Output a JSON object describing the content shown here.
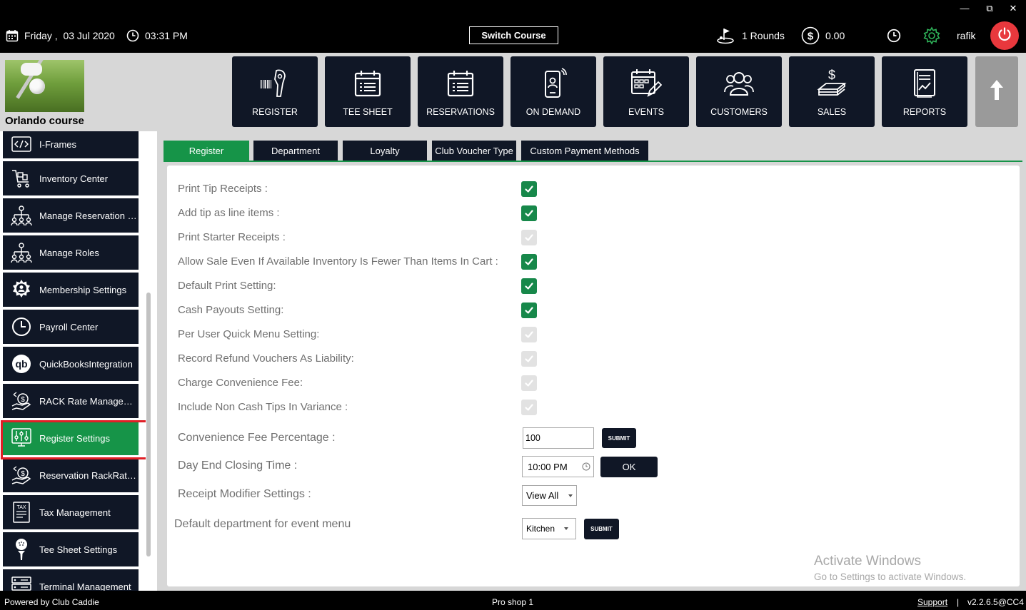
{
  "window_controls": {
    "minimize": "—",
    "restore": "⧉",
    "close": "✕"
  },
  "status_bar": {
    "date": "Friday ,  03 Jul 2020",
    "time": "03:31 PM",
    "switch_course": "Switch Course",
    "rounds": "1 Rounds",
    "balance": "0.00",
    "user": "rafik"
  },
  "course": {
    "name": "Orlando course"
  },
  "nav_tiles": [
    {
      "label": "REGISTER",
      "icon": "barcode-scanner-icon"
    },
    {
      "label": "TEE SHEET",
      "icon": "calendar-list-icon"
    },
    {
      "label": "RESERVATIONS",
      "icon": "calendar-list-icon"
    },
    {
      "label": "ON DEMAND",
      "icon": "mobile-person-icon"
    },
    {
      "label": "EVENTS",
      "icon": "calendar-edit-icon"
    },
    {
      "label": "CUSTOMERS",
      "icon": "users-group-icon"
    },
    {
      "label": "SALES",
      "icon": "money-stack-icon"
    },
    {
      "label": "REPORTS",
      "icon": "report-chart-icon"
    }
  ],
  "sidebar": {
    "items": [
      {
        "label": "I-Frames",
        "icon": "code-icon"
      },
      {
        "label": "Inventory Center",
        "icon": "cart-icon"
      },
      {
        "label": "Manage Reservation R...",
        "icon": "org-chart-icon"
      },
      {
        "label": "Manage Roles",
        "icon": "org-chart-icon"
      },
      {
        "label": "Membership Settings",
        "icon": "gear-user-icon"
      },
      {
        "label": "Payroll Center",
        "icon": "clock-icon"
      },
      {
        "label": "QuickBooksIntegration",
        "icon": "quickbooks-icon"
      },
      {
        "label": "RACK Rate Manageme...",
        "icon": "hand-money-icon"
      },
      {
        "label": "Register Settings",
        "icon": "sliders-icon"
      },
      {
        "label": "Reservation RackRate...",
        "icon": "hand-money-icon"
      },
      {
        "label": "Tax Management",
        "icon": "tax-document-icon"
      },
      {
        "label": "Tee Sheet Settings",
        "icon": "golf-tee-icon"
      },
      {
        "label": "Terminal Management",
        "icon": "server-icon"
      }
    ],
    "active_label": "Register Settings"
  },
  "tabs": [
    {
      "label": "Register",
      "active": true
    },
    {
      "label": "Department",
      "active": false
    },
    {
      "label": "Loyalty",
      "active": false
    },
    {
      "label": "Club Voucher Type",
      "active": false
    },
    {
      "label": "Custom Payment Methods",
      "active": false
    }
  ],
  "settings": [
    {
      "label": "Print Tip Receipts :",
      "checked": true
    },
    {
      "label": "Add tip as line items :",
      "checked": true
    },
    {
      "label": "Print Starter Receipts :",
      "checked": false
    },
    {
      "label": "Allow Sale Even If Available Inventory Is Fewer Than Items In Cart :",
      "checked": true
    },
    {
      "label": "Default Print Setting:",
      "checked": true
    },
    {
      "label": "Cash Payouts Setting:",
      "checked": true
    },
    {
      "label": "Per User Quick Menu Setting:",
      "checked": false
    },
    {
      "label": "Record Refund Vouchers As Liability:",
      "checked": false
    },
    {
      "label": "Charge Convenience Fee:",
      "checked": false
    },
    {
      "label": "Include Non Cash Tips In Variance :",
      "checked": false
    }
  ],
  "convenience_fee": {
    "label": "Convenience Fee Percentage :",
    "value": "100",
    "submit": "SUBMIT"
  },
  "day_end": {
    "label": "Day End Closing Time :",
    "value": "10:00 PM",
    "ok": "OK"
  },
  "receipt_modifier": {
    "label": "Receipt Modifier Settings :",
    "value": "View All"
  },
  "event_department": {
    "label": "Default department for event menu",
    "value": "Kitchen",
    "submit": "SUBMIT"
  },
  "watermark": {
    "title": "Activate Windows",
    "subtitle": "Go to Settings to activate Windows."
  },
  "footer": {
    "powered_by": "Powered by Club Caddie",
    "location": "Pro shop 1",
    "support": "Support",
    "separator": "|",
    "version": "v2.2.6.5@CC4"
  },
  "colors": {
    "accent_green": "#169448",
    "tile_dark": "#101726",
    "highlight_red": "#e01f26",
    "power_red": "#e8383d"
  }
}
